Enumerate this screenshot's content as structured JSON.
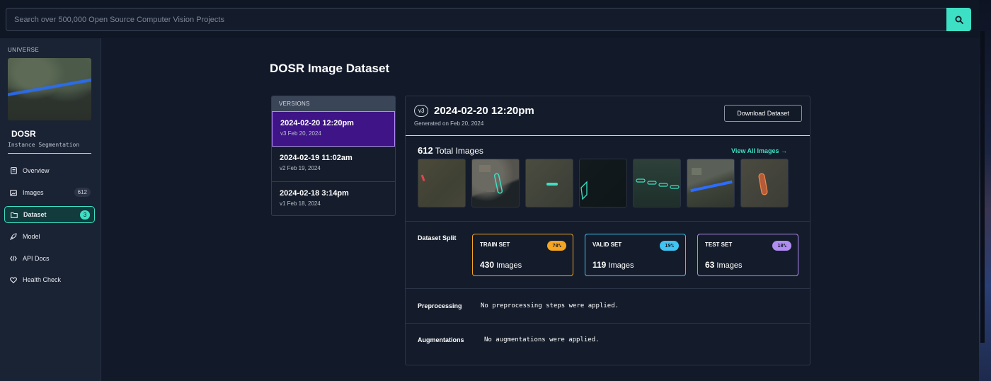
{
  "search": {
    "placeholder": "Search over 500,000 Open Source Computer Vision Projects"
  },
  "sidebar": {
    "universe": "UNIVERSE",
    "dataset_name": "DOSR",
    "dataset_type": "Instance Segmentation",
    "items": [
      {
        "label": "Overview"
      },
      {
        "label": "Images",
        "count": "612"
      },
      {
        "label": "Dataset",
        "count": "3"
      },
      {
        "label": "Model"
      },
      {
        "label": "API Docs"
      },
      {
        "label": "Health Check"
      }
    ]
  },
  "main": {
    "title": "DOSR Image Dataset",
    "versions_header": "VERSIONS",
    "versions": [
      {
        "title": "2024-02-20 12:20pm",
        "sub": "v3 Feb 20, 2024"
      },
      {
        "title": "2024-02-19 11:02am",
        "sub": "v2 Feb 19, 2024"
      },
      {
        "title": "2024-02-18 3:14pm",
        "sub": "v1 Feb 18, 2024"
      }
    ],
    "detail": {
      "version_badge": "v3",
      "title": "2024-02-20 12:20pm",
      "generated": "Generated on Feb 20, 2024",
      "download_label": "Download Dataset",
      "total_count": "612",
      "total_label": "Total Images",
      "view_all": "View All Images →",
      "split_label": "Dataset Split",
      "splits": [
        {
          "name": "TRAIN SET",
          "pct": "70%",
          "count": "430",
          "unit": "Images",
          "color": "#f5a623"
        },
        {
          "name": "VALID SET",
          "pct": "19%",
          "count": "119",
          "unit": "Images",
          "color": "#40c4f2"
        },
        {
          "name": "TEST SET",
          "pct": "10%",
          "count": "63",
          "unit": "Images",
          "color": "#b18cf3"
        }
      ],
      "preprocessing_label": "Preprocessing",
      "preprocessing_value": "No preprocessing steps were applied.",
      "augmentations_label": "Augmentations",
      "augmentations_value": "No augmentations were applied."
    }
  },
  "colors": {
    "accent": "#3de0c4",
    "active_version": "#3e1487",
    "background": "#121a2a"
  }
}
